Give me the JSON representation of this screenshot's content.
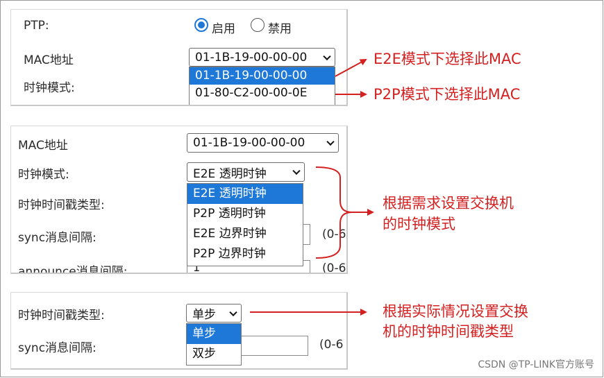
{
  "panel1": {
    "ptp_label": "PTP:",
    "radio_enable": "启用",
    "radio_disable": "禁用",
    "mac_label": "MAC地址",
    "mac_value": "01-1B-19-00-00-00",
    "clock_mode_label": "时钟模式:",
    "mac_options": [
      "01-1B-19-00-00-00",
      "01-80-C2-00-00-0E"
    ]
  },
  "panel2": {
    "mac_label": "MAC地址",
    "mac_value": "01-1B-19-00-00-00",
    "clock_mode_label": "时钟模式:",
    "clock_mode_value": "E2E 透明时钟",
    "timestamp_label": "时钟时间戳类型:",
    "sync_label": "sync消息间隔:",
    "announce_label": "announce消息间隔:",
    "announce_value": "1",
    "range1": "(0-6",
    "range2": "(0-6",
    "clock_mode_options": [
      "E2E 透明时钟",
      "P2P 透明时钟",
      "E2E 边界时钟",
      "P2P 边界时钟"
    ]
  },
  "panel3": {
    "timestamp_label": "时钟时间戳类型:",
    "timestamp_value": "单步",
    "sync_label": "sync消息间隔:",
    "range": "(0-6",
    "timestamp_options": [
      "单步",
      "双步"
    ]
  },
  "annotations": {
    "e2e_mac": "E2E模式下选择此MAC",
    "p2p_mac": "P2P模式下选择此MAC",
    "clock_mode_line1": "根据需求设置交换机",
    "clock_mode_line2": "的时钟模式",
    "timestamp_line1": "根据实际情况设置交换",
    "timestamp_line2": "机的时钟时间戳类型"
  },
  "watermark": "CSDN @TP-LINK官方账号",
  "colors": {
    "annotation_red": "#d42020",
    "selected_blue": "#1e78d7"
  }
}
